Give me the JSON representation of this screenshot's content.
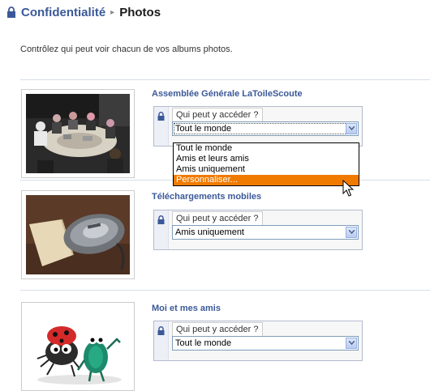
{
  "breadcrumb": {
    "parent": "Confidentialité",
    "separator": "▸",
    "current": "Photos"
  },
  "intro_text": "Contrôlez qui peut voir chacun de vos albums photos.",
  "albums": [
    {
      "title": "Assemblée Générale LaToileScoute",
      "label": "Qui peut y accéder ?",
      "selected": "Tout le monde",
      "thumb": "meeting-photo"
    },
    {
      "title": "Téléchargements mobiles",
      "label": "Qui peut y accéder ?",
      "selected": "Amis uniquement",
      "thumb": "mouse-photo"
    },
    {
      "title": "Moi et mes amis",
      "label": "Qui peut y accéder ?",
      "selected": "Tout le monde",
      "thumb": "bugs-cartoon"
    }
  ],
  "dropdown": {
    "options": [
      "Tout le monde",
      "Amis et leurs amis",
      "Amis uniquement",
      "Personnaliser..."
    ],
    "highlighted_index": 3
  },
  "colors": {
    "link": "#3b5998",
    "highlight": "#f07a00",
    "border": "#b4bbcd"
  },
  "icons": {
    "lock": "lock-icon",
    "arrow": "chevron-down-icon",
    "cursor": "mouse-pointer"
  }
}
